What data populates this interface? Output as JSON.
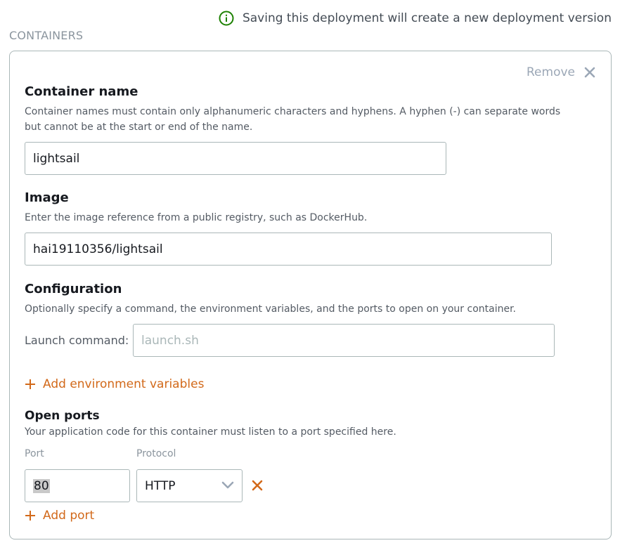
{
  "notice": {
    "text": "Saving this deployment will create a new deployment version",
    "icon": "info-circle-icon"
  },
  "section": {
    "title": "CONTAINERS"
  },
  "panel": {
    "remove_label": "Remove",
    "container_name": {
      "heading": "Container name",
      "description_line1": "Container names must contain only alphanumeric characters and hyphens. A hyphen (-) can separate words",
      "description_line2": "but cannot be at the start or end of the name.",
      "value": "lightsail"
    },
    "image": {
      "heading": "Image",
      "description": "Enter the image reference from a public registry, such as DockerHub.",
      "value": "hai19110356/lightsail"
    },
    "configuration": {
      "heading": "Configuration",
      "description": "Optionally specify a command, the environment variables, and the ports to open on your container.",
      "launch_label": "Launch command:",
      "launch_placeholder": "launch.sh",
      "add_env_label": "Add environment variables"
    },
    "open_ports": {
      "heading": "Open ports",
      "description": "Your application code for this container must listen to a port specified here.",
      "port_label": "Port",
      "protocol_label": "Protocol",
      "port_value": "80",
      "protocol_value": "HTTP",
      "add_port_label": "Add port"
    }
  },
  "colors": {
    "accent": "#d2691a",
    "success": "#1d8102",
    "muted": "#9ba7b6",
    "border": "#aab7b8"
  }
}
